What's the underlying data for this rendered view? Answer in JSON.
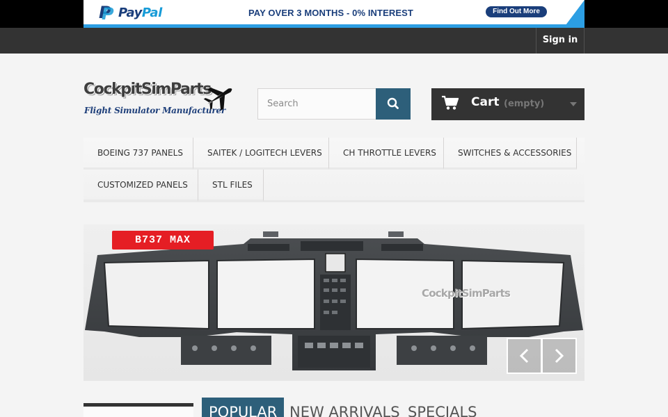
{
  "banner": {
    "brand_pay": "Pay",
    "brand_pal": "Pal",
    "message": "PAY OVER 3 MONTHS - 0% INTEREST",
    "button_label": "Find Out More",
    "colors": {
      "navy": "#1a3e7b",
      "blue": "#179bd7"
    }
  },
  "topbar": {
    "signin_label": "Sign in"
  },
  "logo": {
    "title": "CockpitSimParts",
    "subtitle": "Flight Simulator Manufacturer",
    "icon": "airplane-icon"
  },
  "search": {
    "placeholder": "Search",
    "value": "",
    "icon": "search-icon"
  },
  "cart": {
    "label": "Cart",
    "status": "(empty)",
    "icon": "shopping-cart-icon"
  },
  "menu": {
    "items": [
      {
        "label": "Boeing 737 Panels"
      },
      {
        "label": "Saitek / Logitech Levers"
      },
      {
        "label": "CH Throttle Levers"
      },
      {
        "label": "Switches & Accessories"
      },
      {
        "label": "Customized Panels"
      },
      {
        "label": "STL Files"
      }
    ]
  },
  "slider": {
    "badge": "B737 MAX",
    "watermark": "CockpitSimParts",
    "prev_icon": "chevron-left-icon",
    "next_icon": "chevron-right-icon"
  },
  "tabs": [
    {
      "label": "Popular",
      "active": true
    },
    {
      "label": "New arrivals",
      "active": false
    },
    {
      "label": "Specials",
      "active": false
    }
  ],
  "colors": {
    "accent": "#2d5f7a",
    "dark": "#333333",
    "badge_red": "#e51e24"
  }
}
